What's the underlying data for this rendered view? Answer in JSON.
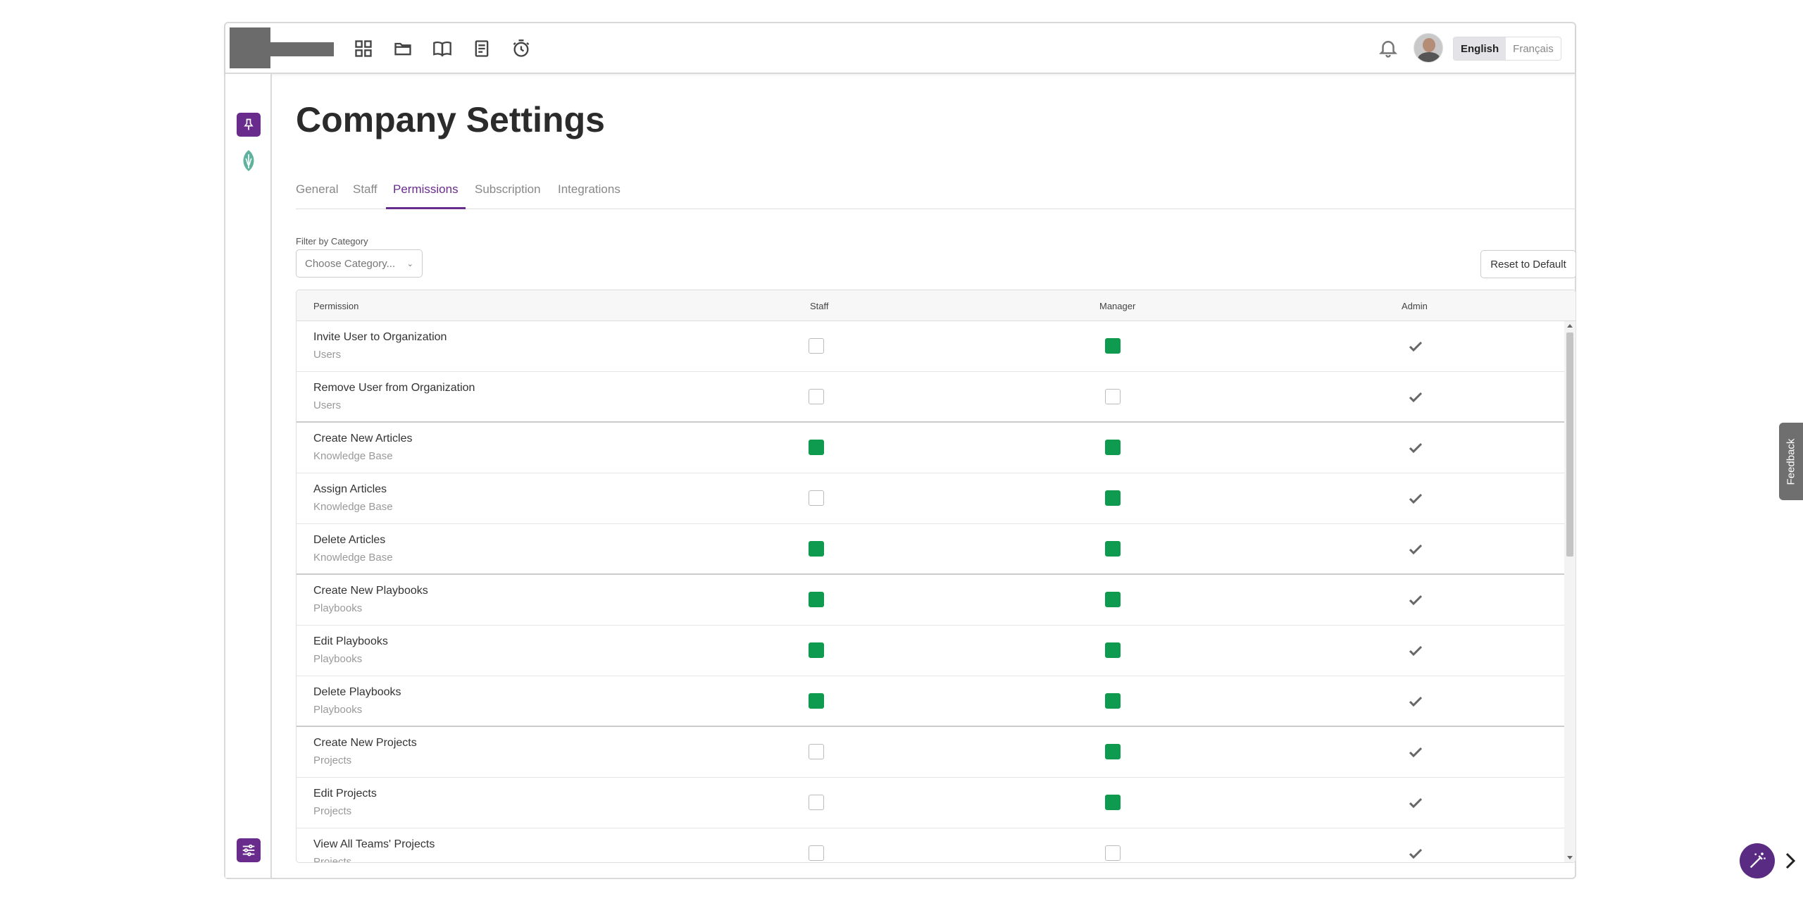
{
  "header": {
    "nav_icons": [
      "grid-icon",
      "folder-icon",
      "book-icon",
      "document-icon",
      "timer-icon"
    ],
    "languages": [
      {
        "label": "English",
        "active": true
      },
      {
        "label": "Français",
        "active": false
      }
    ]
  },
  "sidebar": {
    "icons": [
      "pin-icon",
      "leaf-logo-icon",
      "sliders-icon"
    ],
    "accent": "#6a2c8c"
  },
  "page": {
    "title": "Company Settings",
    "tabs": [
      {
        "label": "General",
        "active": false
      },
      {
        "label": "Staff",
        "active": false
      },
      {
        "label": "Permissions",
        "active": true
      },
      {
        "label": "Subscription",
        "active": false
      },
      {
        "label": "Integrations",
        "active": false
      }
    ],
    "filter": {
      "label": "Filter by Category",
      "placeholder": "Choose Category..."
    },
    "reset_label": "Reset to Default"
  },
  "table": {
    "columns": [
      "Permission",
      "Staff",
      "Manager",
      "Admin"
    ],
    "checked_color": "#0e9a4f",
    "rows": [
      {
        "name": "Invite User to Organization",
        "category": "Users",
        "staff": false,
        "manager": true,
        "admin": true
      },
      {
        "name": "Remove User from Organization",
        "category": "Users",
        "staff": false,
        "manager": false,
        "admin": true
      },
      {
        "name": "Create New Articles",
        "category": "Knowledge Base",
        "staff": true,
        "manager": true,
        "admin": true
      },
      {
        "name": "Assign Articles",
        "category": "Knowledge Base",
        "staff": false,
        "manager": true,
        "admin": true
      },
      {
        "name": "Delete Articles",
        "category": "Knowledge Base",
        "staff": true,
        "manager": true,
        "admin": true
      },
      {
        "name": "Create New Playbooks",
        "category": "Playbooks",
        "staff": true,
        "manager": true,
        "admin": true
      },
      {
        "name": "Edit Playbooks",
        "category": "Playbooks",
        "staff": true,
        "manager": true,
        "admin": true
      },
      {
        "name": "Delete Playbooks",
        "category": "Playbooks",
        "staff": true,
        "manager": true,
        "admin": true
      },
      {
        "name": "Create New Projects",
        "category": "Projects",
        "staff": false,
        "manager": true,
        "admin": true
      },
      {
        "name": "Edit Projects",
        "category": "Projects",
        "staff": false,
        "manager": true,
        "admin": true
      },
      {
        "name": "View All Teams' Projects",
        "category": "Projects",
        "staff": false,
        "manager": false,
        "admin": true
      }
    ]
  },
  "feedback_label": "Feedback"
}
